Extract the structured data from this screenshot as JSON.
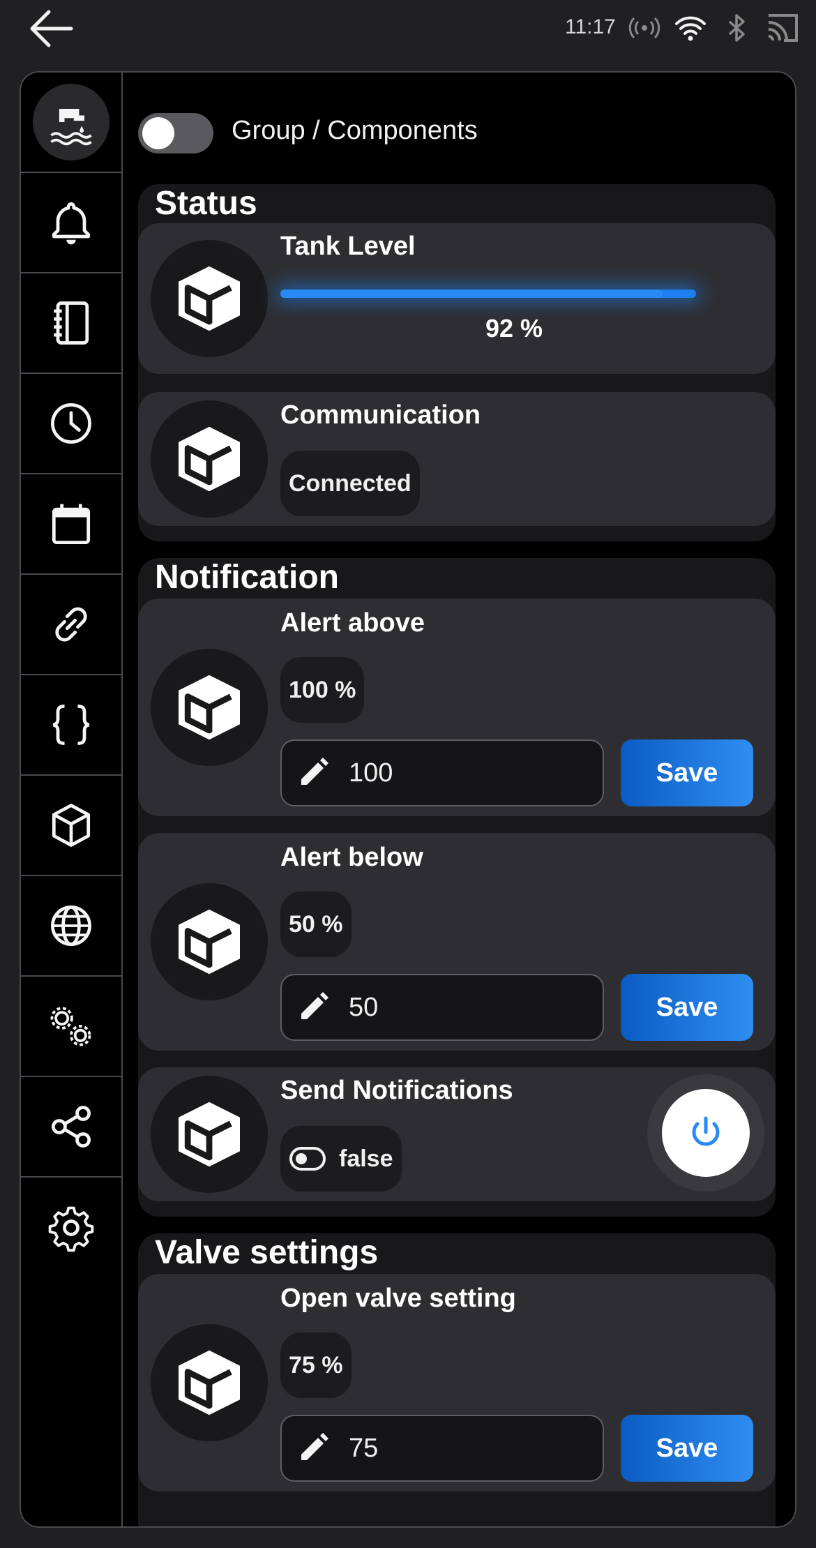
{
  "statusbar": {
    "time": "11:17"
  },
  "group_toggle": {
    "label": "Group / Components",
    "on": false
  },
  "sections": {
    "status": {
      "title": "Status",
      "tank_level": {
        "title": "Tank Level",
        "value": 92,
        "value_label": "92 %"
      },
      "communication": {
        "title": "Communication",
        "value": "Connected"
      }
    },
    "notification": {
      "title": "Notification",
      "alert_above": {
        "title": "Alert above",
        "value": "100 %",
        "input": "100",
        "save": "Save"
      },
      "alert_below": {
        "title": "Alert below",
        "value": "50 %",
        "input": "50",
        "save": "Save"
      },
      "send_notifications": {
        "title": "Send Notifications",
        "value": "false"
      }
    },
    "valve": {
      "title": "Valve settings",
      "open_valve": {
        "title": "Open valve setting",
        "value": "75 %",
        "input": "75",
        "save": "Save"
      }
    }
  },
  "colors": {
    "accent": "#2a8af5",
    "card": "#2e2e32",
    "section": "#18181a"
  },
  "sidebar_icons": [
    "water-tap-icon",
    "bell-icon",
    "notebook-icon",
    "clock-icon",
    "calendar-icon",
    "link-icon",
    "code-braces-icon",
    "cube-icon",
    "globe-icon",
    "gears-icon",
    "share-icon",
    "settings-icon"
  ]
}
